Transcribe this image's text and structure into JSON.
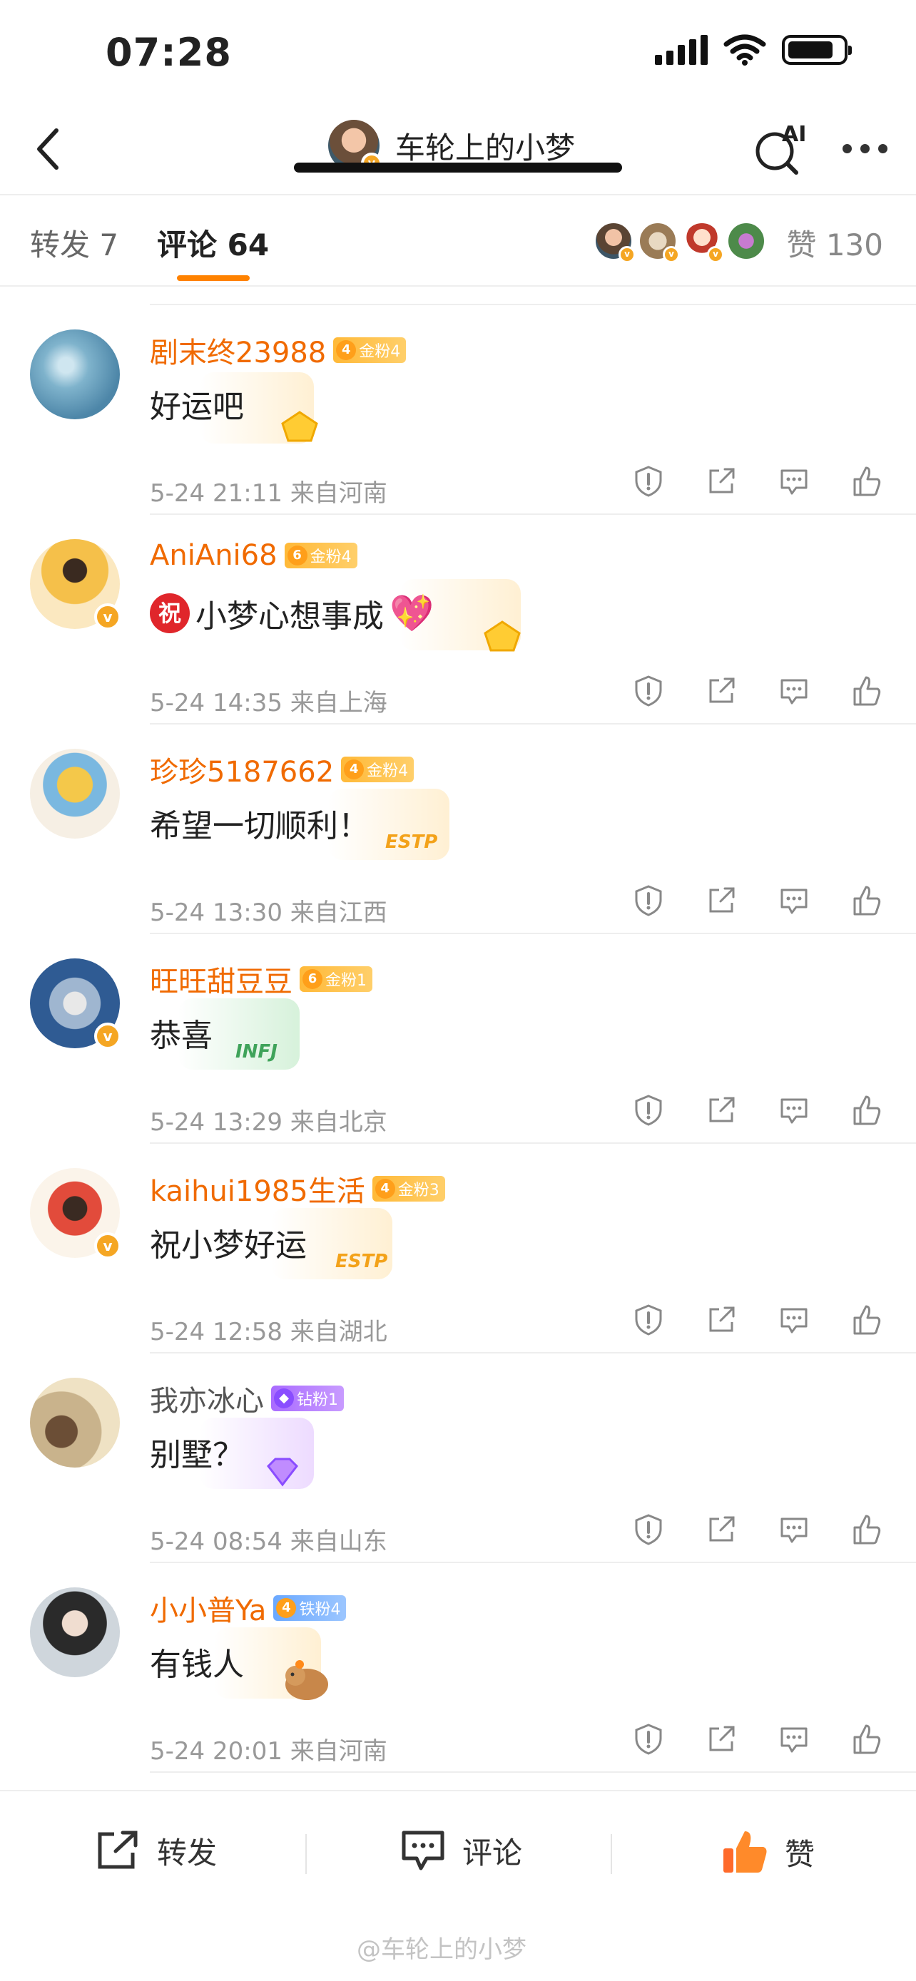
{
  "status_bar": {
    "time": "07:28"
  },
  "nav": {
    "title": "车轮上的小梦",
    "ai_label": "AI"
  },
  "tabs": {
    "repost": "转发 7",
    "comment": "评论 64",
    "likes": "赞 130"
  },
  "comments": [
    {
      "name": "剧末终23988",
      "fan_level": "4",
      "fan_badge": "金粉4",
      "text": "好运吧",
      "time": "5-24 21:11",
      "location": "来自河南"
    },
    {
      "name": "AniAni68",
      "fan_level": "6",
      "fan_badge": "金粉4",
      "badge_prefix": "祝",
      "text": "小梦心想事成",
      "emoji": "💖",
      "time": "5-24 14:35",
      "location": "来自上海"
    },
    {
      "name": "珍珍5187662",
      "fan_level": "4",
      "fan_badge": "金粉4",
      "text": "希望一切顺利！",
      "deco_tag": "ESTP",
      "time": "5-24 13:30",
      "location": "来自江西"
    },
    {
      "name": "旺旺甜豆豆",
      "fan_level": "6",
      "fan_badge": "金粉1",
      "text": "恭喜",
      "deco_tag": "INFJ",
      "time": "5-24 13:29",
      "location": "来自北京"
    },
    {
      "name": "kaihui1985生活",
      "fan_level": "4",
      "fan_badge": "金粉3",
      "text": "祝小梦好运",
      "deco_tag": "ESTP",
      "time": "5-24 12:58",
      "location": "来自湖北"
    },
    {
      "name": "我亦冰心",
      "fan_badge": "钻粉1",
      "text": "别墅？",
      "time": "5-24 08:54",
      "location": "来自山东"
    },
    {
      "name": "小小普Ya",
      "fan_level": "4",
      "fan_badge": "铁粉4",
      "text": "有钱人",
      "time": "5-24 20:01",
      "location": "来自河南"
    }
  ],
  "bottom_bar": {
    "repost": "转发",
    "comment": "评论",
    "like": "赞"
  },
  "watermark": "@车轮上的小梦",
  "colors": {
    "accent": "#ff8200",
    "username": "#f06a00",
    "like_active": "#ff6a2a"
  }
}
